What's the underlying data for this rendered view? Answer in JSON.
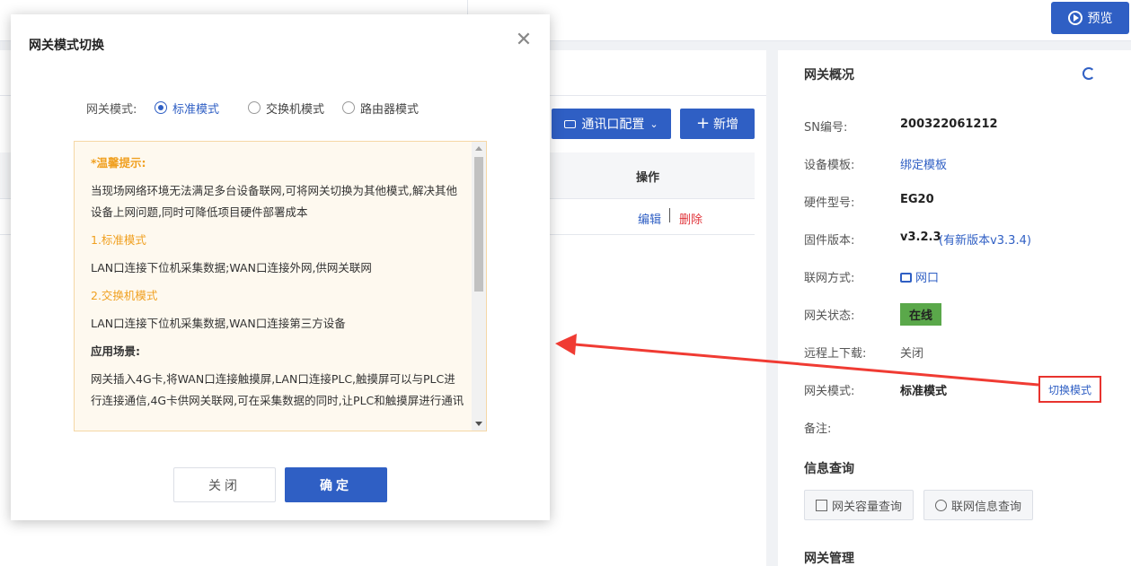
{
  "topbar": {
    "preview_label": "预览"
  },
  "main": {
    "port_config_label": "通讯口配置",
    "add_label": "新增",
    "col_operation": "操作",
    "row_edit": "编辑",
    "row_delete": "删除"
  },
  "side": {
    "title": "网关概况",
    "rows": [
      {
        "key": "SN编号:",
        "value": "200322061212"
      },
      {
        "key": "设备模板:",
        "value": "绑定模板"
      },
      {
        "key": "硬件型号:",
        "value": "EG20"
      },
      {
        "key": "固件版本:",
        "value": "v3.2.3",
        "extra": "(有新版本v3.3.4)"
      },
      {
        "key": "联网方式:",
        "value": "网口"
      },
      {
        "key": "网关状态:",
        "value": "在线"
      },
      {
        "key": "远程上下载:",
        "value": "关闭"
      },
      {
        "key": "网关模式:",
        "value": "标准模式"
      },
      {
        "key": "备注:",
        "value": ""
      }
    ],
    "switch_mode_label": "切换模式",
    "info_query_title": "信息查询",
    "capacity_query_label": "网关容量查询",
    "network_query_label": "联网信息查询",
    "gateway_manage_title": "网关管理"
  },
  "modal": {
    "title": "网关模式切换",
    "mode_label": "网关模式:",
    "options": [
      "标准模式",
      "交换机模式",
      "路由器模式"
    ],
    "selected": "标准模式",
    "tips": {
      "heading": "*温馨提示:",
      "intro": "当现场网络环境无法满足多台设备联网,可将网关切换为其他模式,解决其他设备上网问题,同时可降低项目硬件部署成本",
      "mode1_title": "1.标准模式",
      "mode1_desc": "LAN口连接下位机采集数据;WAN口连接外网,供网关联网",
      "mode2_title": "2.交换机模式",
      "mode2_desc": "LAN口连接下位机采集数据,WAN口连接第三方设备",
      "scene_title": "应用场景:",
      "scene_desc": "网关插入4G卡,将WAN口连接触摸屏,LAN口连接PLC,触摸屏可以与PLC进行连接通信,4G卡供网关联网,可在采集数据的同时,让PLC和触摸屏进行通讯"
    },
    "close_label": "关闭",
    "ok_label": "确定"
  }
}
